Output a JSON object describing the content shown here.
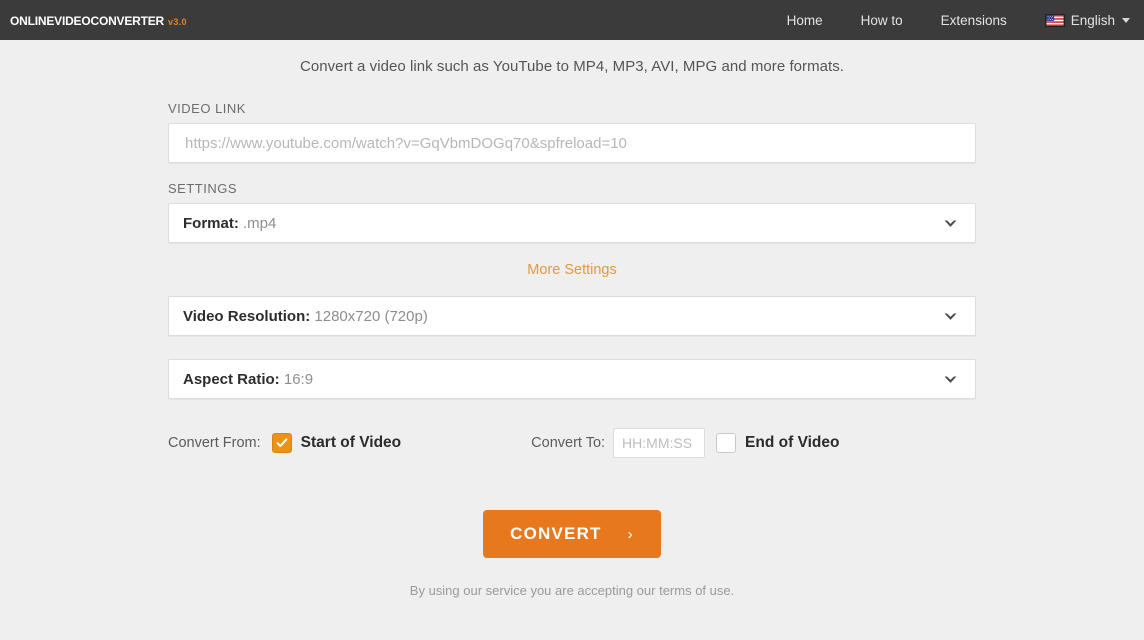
{
  "header": {
    "logo": {
      "part1": "Online",
      "part2": "Video",
      "part3": "Converter",
      "version": "v3.0"
    },
    "nav": [
      {
        "label": "Home",
        "name": "nav-home"
      },
      {
        "label": "How to",
        "name": "nav-how-to"
      },
      {
        "label": "Extensions",
        "name": "nav-extensions"
      }
    ],
    "language": {
      "label": "English",
      "flag_icon": "us-flag-icon",
      "caret_icon": "chevron-down-icon"
    },
    "background_color": "#3b3b3b"
  },
  "tagline": "Convert a video link such as YouTube to MP4, MP3, AVI, MPG and more formats.",
  "video_link": {
    "label": "VIDEO LINK",
    "value": "",
    "placeholder": "https://www.youtube.com/watch?v=GqVbmDOGq70&spfreload=10"
  },
  "settings": {
    "label": "SETTINGS",
    "format": {
      "key": "Format:",
      "value": ".mp4",
      "chevron_icon": "chevron-down-icon"
    },
    "more_settings": "More Settings",
    "video_resolution": {
      "key": "Video Resolution:",
      "value": "1280x720 (720p)",
      "chevron_icon": "chevron-down-icon"
    },
    "aspect_ratio": {
      "key": "Aspect Ratio:",
      "value": "16:9",
      "chevron_icon": "chevron-down-icon"
    }
  },
  "range": {
    "from_label": "Convert From:",
    "from_option": "Start of Video",
    "from_checked": true,
    "to_label": "Convert To:",
    "to_time_value": "",
    "to_time_placeholder": "HH:MM:SS",
    "to_option": "End of Video",
    "to_checked": false
  },
  "convert_button": {
    "label": "CONVERT",
    "arrow_icon": "chevron-right-icon",
    "arrow_glyph": "›"
  },
  "terms": "By using our service you are accepting our terms of use.",
  "colors": {
    "accent_orange": "#e8781e",
    "checkbox_orange": "#eb9316",
    "link_orange": "#e09a3c",
    "header_dark": "#3b3b3b",
    "page_background": "#efefef"
  }
}
